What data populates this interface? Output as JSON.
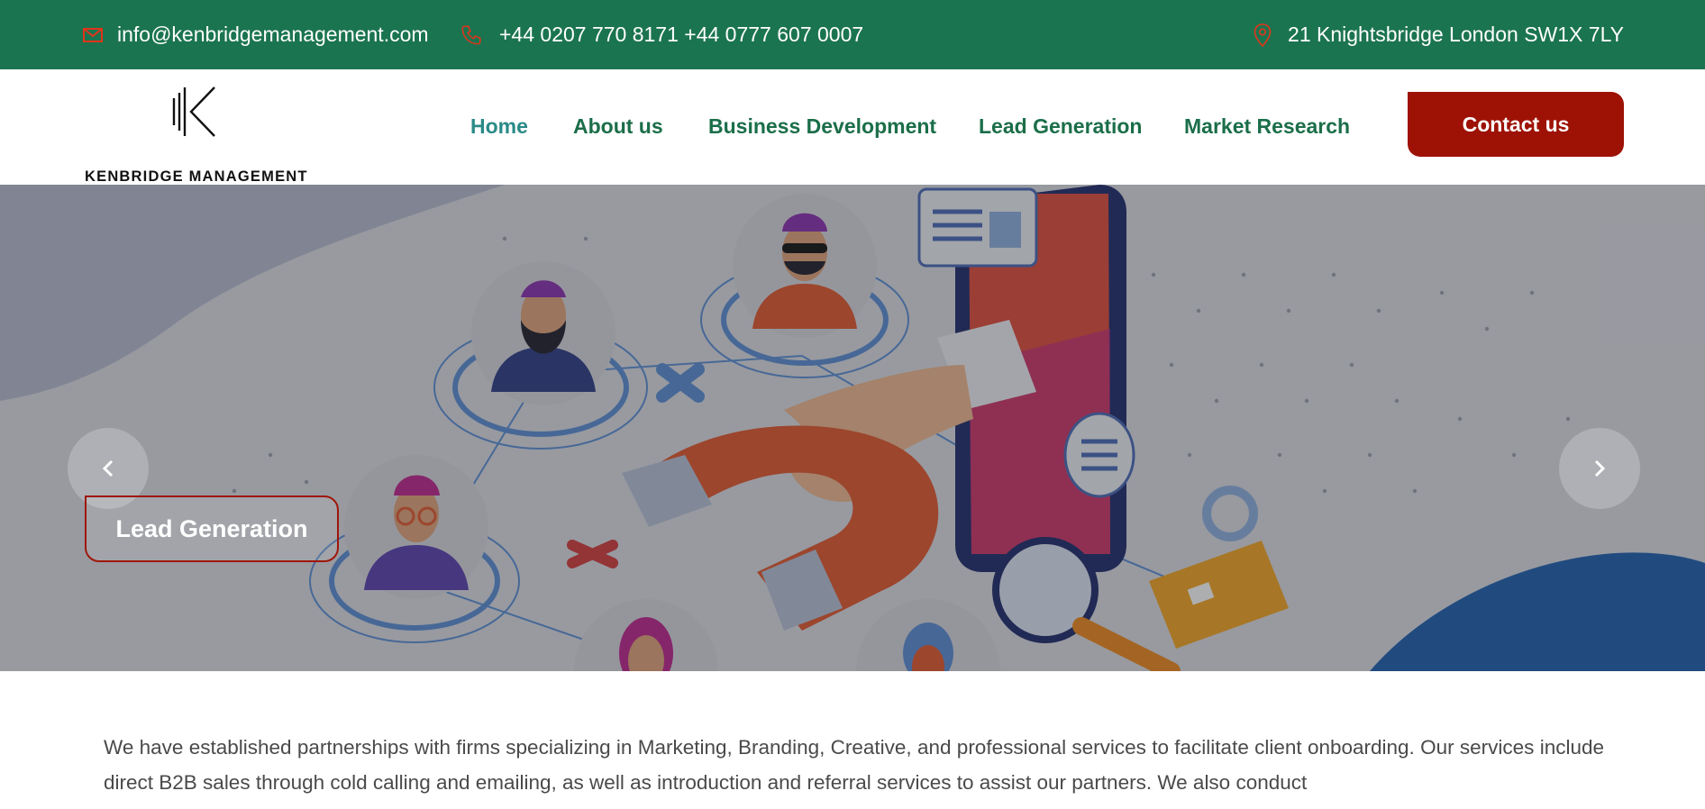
{
  "topbar": {
    "email": "info@kenbridgemanagement.com",
    "phone": "+44 0207 770 8171 +44 0777 607 0007",
    "address": "21 Knightsbridge London SW1X 7LY"
  },
  "logo": {
    "name": "KENBRIDGE MANAGEMENT"
  },
  "nav": {
    "items": [
      {
        "label": "Home"
      },
      {
        "label": "About us"
      },
      {
        "label": "Business Development"
      },
      {
        "label": "Lead Generation"
      },
      {
        "label": "Market Research"
      }
    ],
    "contact_label": "Contact us"
  },
  "hero": {
    "slide_label": "Lead Generation"
  },
  "content": {
    "paragraph": "We have established partnerships with firms specializing in Marketing, Branding, Creative, and professional services to facilitate client onboarding. Our services include direct B2B sales through cold calling and emailing, as well as introduction and referral services to assist our partners. We also conduct"
  },
  "colors": {
    "topbar_bg": "#1b7450",
    "nav_text": "#1b6e49",
    "nav_active": "#2a8a86",
    "accent_red": "#9e1206"
  },
  "icons": [
    "envelope-icon",
    "phone-icon",
    "location-pin-icon",
    "chevron-left-icon",
    "chevron-right-icon"
  ]
}
